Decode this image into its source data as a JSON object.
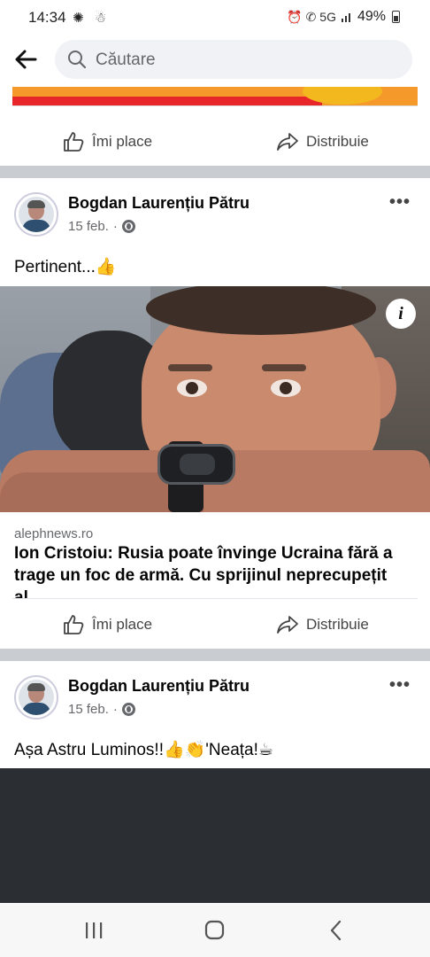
{
  "status_bar": {
    "time": "14:34",
    "left_icons": "✺ ☃",
    "right_icons": "⏰ ✆ 5G",
    "battery": "49%"
  },
  "search": {
    "placeholder": "Căutare"
  },
  "actions": {
    "like_label": "Îmi place",
    "share_label": "Distribuie"
  },
  "posts": [
    {
      "author": "Bogdan Laurențiu Pătru",
      "date": "15 feb.",
      "dot": "·",
      "more": "•••",
      "text": "Pertinent...👍",
      "link": {
        "domain": "alephnews.ro",
        "title": "Ion Cristoiu: Rusia poate învinge Ucraina fără a trage un foc de armă. Cu sprijinul neprecupețit al…",
        "info_label": "i"
      }
    },
    {
      "author": "Bogdan Laurențiu Pătru",
      "date": "15 feb.",
      "dot": "·",
      "more": "•••",
      "text": "Așa  Astru Luminos!!👍👏'Neața!☕"
    }
  ],
  "colors": {
    "separator": "#c9ccd1",
    "secondary_text": "#65676b",
    "search_bg": "#f0f2f5"
  }
}
